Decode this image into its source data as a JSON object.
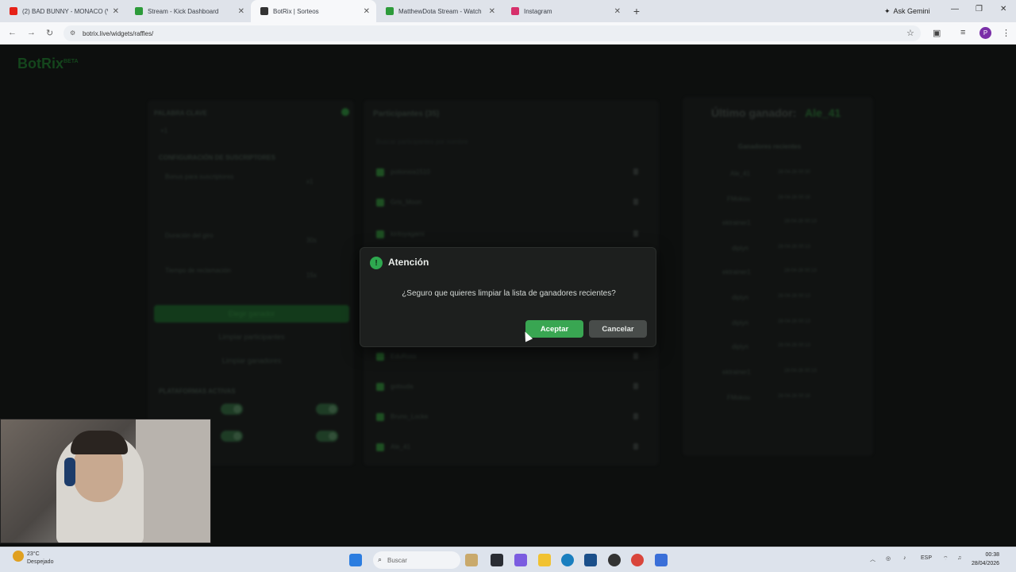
{
  "browser": {
    "tabs": [
      {
        "title": "(2) BAD BUNNY - MONACO (V",
        "icon": "youtube-icon",
        "color": "#e62117"
      },
      {
        "title": "Stream - Kick Dashboard",
        "icon": "kick-icon",
        "color": "#2d9b3a"
      },
      {
        "title": "BotRix | Sorteos",
        "icon": "botrix-icon",
        "color": "#333333"
      },
      {
        "title": "MatthewDota Stream - Watch",
        "icon": "kick-icon",
        "color": "#2d9b3a"
      },
      {
        "title": "Instagram",
        "icon": "instagram-icon",
        "color": "#d6306b"
      }
    ],
    "new_tab": "+",
    "ask_gemini": "Ask Gemini",
    "url": "botrix.live/widgets/raffles/",
    "profile_initial": "P"
  },
  "app": {
    "logo": "BotRix",
    "logo_badge": "BETA",
    "left": {
      "keyword_label": "PALABRA CLAVE",
      "keyword_value": "+1",
      "subs_config_label": "CONFIGURACIÓN DE SUSCRIPTORES",
      "bonus_label": "Bonus para suscriptores",
      "bonus_value": "x1",
      "duration_label": "Duración del giro",
      "duration_value": "30s",
      "claim_label": "Tiempo de reclamación",
      "claim_value": "15s",
      "pick_winner": "Elegir ganador",
      "clear_participants": "Limpiar participantes",
      "clear_winners": "Limpiar ganadores",
      "platforms_label": "PLATAFORMAS ACTIVAS"
    },
    "middle": {
      "title": "Participantes (35)",
      "search_placeholder": "Buscar participantes por nombre",
      "participants": [
        "potionsia1510",
        "Gris_Moon",
        "kiritoyagami",
        "EduRoss",
        "gotsuda",
        "Bruno_Locke",
        "Ale_41"
      ]
    },
    "right": {
      "last_winner_label": "Último ganador:",
      "last_winner_name": "Ale_41",
      "recent_label": "Ganadores recientes",
      "recent": [
        {
          "name": "Ale_41",
          "date": "28-04-26 00:30"
        },
        {
          "name": "FMokou",
          "date": "28-04-26 00:16"
        },
        {
          "name": "ektrainer1",
          "date": "28-04-26 00:13"
        },
        {
          "name": "diplyn",
          "date": "28-04-26 00:13"
        },
        {
          "name": "ektrainer1",
          "date": "28-04-26 00:13"
        },
        {
          "name": "diplyn",
          "date": "28-04-26 00:13"
        },
        {
          "name": "diplyn",
          "date": "28-04-26 00:13"
        },
        {
          "name": "diplyn",
          "date": "28-04-26 00:13"
        },
        {
          "name": "ektrainer1",
          "date": "28-04-26 00:13"
        },
        {
          "name": "FMokou",
          "date": "28-04-26 00:16"
        }
      ]
    }
  },
  "dialog": {
    "title": "Atención",
    "icon": "!",
    "message": "¿Seguro que quieres limpiar la lista de ganadores recientes?",
    "accept": "Aceptar",
    "cancel": "Cancelar"
  },
  "taskbar": {
    "temperature": "23°C",
    "weather": "Despejado",
    "search_placeholder": "Buscar",
    "lang": "ESP",
    "time": "00:38",
    "date": "28/04/2026"
  }
}
